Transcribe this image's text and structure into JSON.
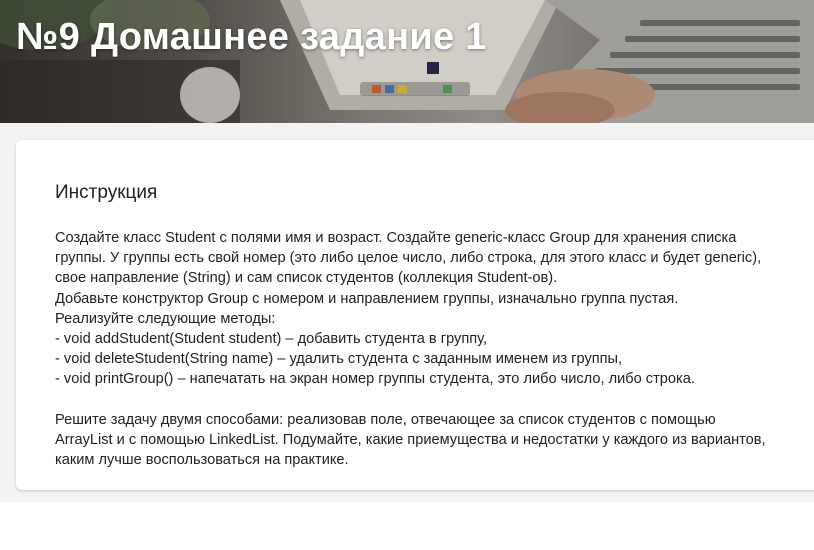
{
  "header": {
    "title": "№9 Домашнее задание 1"
  },
  "instruction": {
    "heading": "Инструкция",
    "paragraph1": [
      "Создайте класс Student с полями имя и возраст. Создайте generic-класс Group для хранения списка",
      "группы. У группы есть свой номер (это либо целое число, либо строка, для этого класс и будет generic),",
      "свое направление (String) и сам список студентов (коллекция Student-ов).",
      "Добавьте конструктор Group с номером и направлением группы, изначально группа пустая.",
      "Реализуйте следующие методы:",
      "- void addStudent(Student student) – добавить студента в группу,",
      "- void deleteStudent(String name) – удалить студента с заданным именем из группы,",
      "- void printGroup() – напечатать на экран номер группы студента, это либо число, либо строка."
    ],
    "paragraph2": [
      "Решите задачу двумя способами: реализовав поле, отвечающее за список студентов с помощью",
      "ArrayList и с помощью LinkedList. Подумайте, какие приемущества и недостатки у каждого из вариантов,",
      "каким лучше воспользоваться на практике."
    ]
  }
}
